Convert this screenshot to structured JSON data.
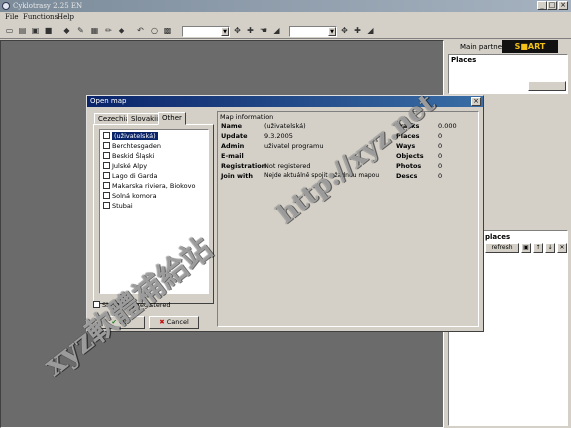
{
  "window": {
    "title": "Cyklotrasy 2.25 EN",
    "min": "_",
    "max": "□",
    "close": "×"
  },
  "menu": [
    "File",
    "Functions",
    "Help"
  ],
  "partner": {
    "label": "Main partner",
    "logo_text": "S■ART"
  },
  "right_panel": {
    "places_header": "Places",
    "places2_header": "places",
    "refresh_label": "refresh"
  },
  "dialog": {
    "title": "Open map",
    "tabs": [
      "Cezechia",
      "Slovakiia",
      "Other"
    ],
    "active_tab": "Other",
    "items": [
      {
        "label": "(uživatelská)",
        "selected": true
      },
      {
        "label": "Berchtesgaden"
      },
      {
        "label": "Beskid Śląski"
      },
      {
        "label": "Julské Alpy"
      },
      {
        "label": "Lago di Garda"
      },
      {
        "label": "Makarska riviera, Biokovo"
      },
      {
        "label": "Solná komora"
      },
      {
        "label": "Stubai"
      }
    ],
    "show_registered_label": "Show only registered",
    "ok_label": "OK",
    "cancel_label": "Cancel",
    "info_header": "Map information",
    "info_left": [
      {
        "label": "Name",
        "value": "(uživatelská)"
      },
      {
        "label": "Update",
        "value": "9.3.2005"
      },
      {
        "label": "Admin",
        "value": "uživatel programu"
      },
      {
        "label": "E-mail",
        "value": ""
      },
      {
        "label": "Registration",
        "value": "Not registered"
      },
      {
        "label": "Join with",
        "value": "Nejde aktuálně spojit s žádnou mapou"
      }
    ],
    "info_right": [
      {
        "label": "Tracks",
        "value": "0.000"
      },
      {
        "label": "Places",
        "value": "0"
      },
      {
        "label": "Ways",
        "value": "0"
      },
      {
        "label": "Objects",
        "value": "0"
      },
      {
        "label": "Photos",
        "value": "0"
      },
      {
        "label": "Descs",
        "value": "0"
      }
    ]
  },
  "watermark": {
    "line1": "xyz軟體補給站",
    "line2": "http://xyz.net"
  }
}
